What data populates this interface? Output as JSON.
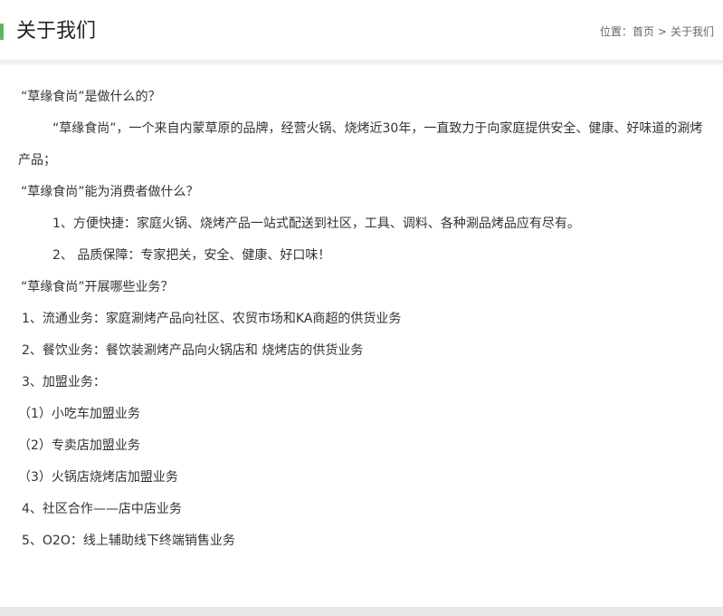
{
  "header": {
    "title": "关于我们",
    "accent_color": "#5cb85c"
  },
  "breadcrumb": {
    "label": "位置：",
    "home": "首页",
    "separator": ">",
    "current": "关于我们"
  },
  "content": {
    "lines": [
      "“草缘食尚”是做什么的？",
      "“草缘食尚”，一个来自内蒙草原的品牌，经营火锅、烧烤近30年，一直致力于向家庭提供安全、健康、好味道的涮烤产品；",
      "“草缘食尚”能为消费者做什么？",
      "1、方便快捷：家庭火锅、烧烤产品一站式配送到社区，工具、调料、各种涮品烤品应有尽有。",
      "2、 品质保障：专家把关，安全、健康、好口味！",
      "“草缘食尚”开展哪些业务？",
      "1、流通业务：家庭涮烤产品向社区、农贸市场和KA商超的供货业务",
      "2、餐饮业务：餐饮装涮烤产品向火锅店和 烧烤店的供货业务",
      "3、加盟业务：",
      "（1）小吃车加盟业务",
      "（2）专卖店加盟业务",
      "（3）火锅店烧烤店加盟业务",
      "4、社区合作——店中店业务",
      "5、O2O：线上辅助线下终端销售业务"
    ]
  }
}
